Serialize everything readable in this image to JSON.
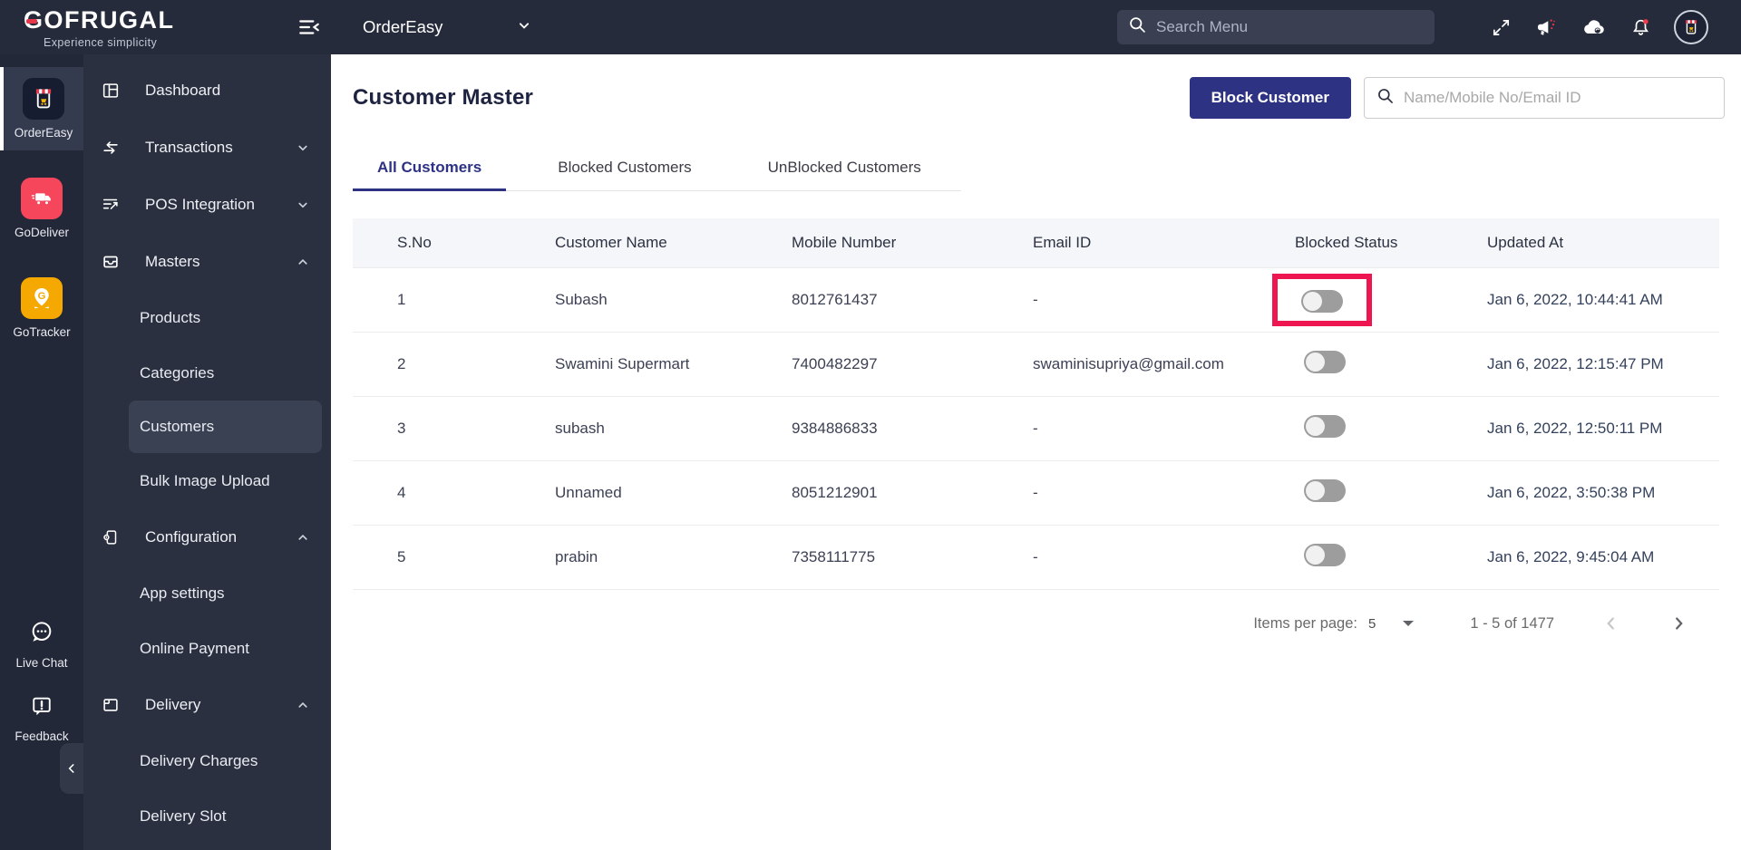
{
  "topbar": {
    "brand": "GOFRUGAL",
    "tagline": "Experience simplicity",
    "product": "OrderEasy",
    "search_placeholder": "Search Menu"
  },
  "rail": {
    "ordereasy": "OrderEasy",
    "godeliver": "GoDeliver",
    "gotracker": "GoTracker",
    "live_chat": "Live Chat",
    "feedback": "Feedback"
  },
  "sidebar": {
    "dashboard": "Dashboard",
    "transactions": "Transactions",
    "pos_integration": "POS Integration",
    "masters": "Masters",
    "products": "Products",
    "categories": "Categories",
    "customers": "Customers",
    "bulk_image_upload": "Bulk Image Upload",
    "configuration": "Configuration",
    "app_settings": "App settings",
    "online_payment": "Online Payment",
    "delivery": "Delivery",
    "delivery_charges": "Delivery Charges",
    "delivery_slot": "Delivery Slot"
  },
  "main": {
    "title": "Customer Master",
    "block_button": "Block Customer",
    "search_placeholder": "Name/Mobile No/Email ID",
    "tabs": [
      "All Customers",
      "Blocked Customers",
      "UnBlocked Customers"
    ],
    "active_tab": "All Customers",
    "table": {
      "columns": [
        "S.No",
        "Customer Name",
        "Mobile Number",
        "Email ID",
        "Blocked Status",
        "Updated At"
      ],
      "rows": [
        {
          "sno": "1",
          "name": "Subash",
          "mobile": "8012761437",
          "email": "-",
          "blocked": false,
          "highlighted": true,
          "updated": "Jan 6, 2022, 10:44:41 AM"
        },
        {
          "sno": "2",
          "name": "Swamini Supermart",
          "mobile": "7400482297",
          "email": "swaminisupriya@gmail.com",
          "blocked": false,
          "highlighted": false,
          "updated": "Jan 6, 2022, 12:15:47 PM"
        },
        {
          "sno": "3",
          "name": "subash",
          "mobile": "9384886833",
          "email": "-",
          "blocked": false,
          "highlighted": false,
          "updated": "Jan 6, 2022, 12:50:11 PM"
        },
        {
          "sno": "4",
          "name": "Unnamed",
          "mobile": "8051212901",
          "email": "-",
          "blocked": false,
          "highlighted": false,
          "updated": "Jan 6, 2022, 3:50:38 PM"
        },
        {
          "sno": "5",
          "name": "prabin",
          "mobile": "7358111775",
          "email": "-",
          "blocked": false,
          "highlighted": false,
          "updated": "Jan 6, 2022, 9:45:04 AM"
        }
      ]
    },
    "pagination": {
      "items_per_page_label": "Items per page:",
      "items_per_page": "5",
      "range": "1 - 5 of 1477"
    }
  },
  "icons": {
    "collapse-menu": "≡‹",
    "chevron-down": "⌄",
    "chevron-up": "⌃",
    "search": "⌕",
    "fullscreen": "⤢",
    "announcement-megaphone": "📢",
    "cloud-sync": "☁",
    "notification-bell": "🔔",
    "store-avatar": "🏪",
    "delivery-truck": "🚚",
    "location-pin": "📍",
    "chat-bubble": "💬",
    "feedback-bubble": "❕",
    "dashboard": "▦",
    "transactions": "⇆",
    "pos-integration": "☰",
    "masters": "🗃",
    "configuration": "⚙",
    "delivery-box": "📦",
    "dropdown-caret": "▾",
    "prev-page": "‹",
    "next-page": "›"
  },
  "colors": {
    "topbar_bg": "#262b3b",
    "rail_bg": "#232838",
    "sidebar_bg": "#2b3040",
    "accent_indigo": "#2d3282",
    "highlight_red": "#ed1650",
    "godeliver_red": "#f5465c",
    "gotracker_orange": "#f5a800",
    "toggle_track": "#9d9d9d",
    "toggle_knob": "#f1f1f1",
    "table_header_bg": "#f5f6f9"
  }
}
